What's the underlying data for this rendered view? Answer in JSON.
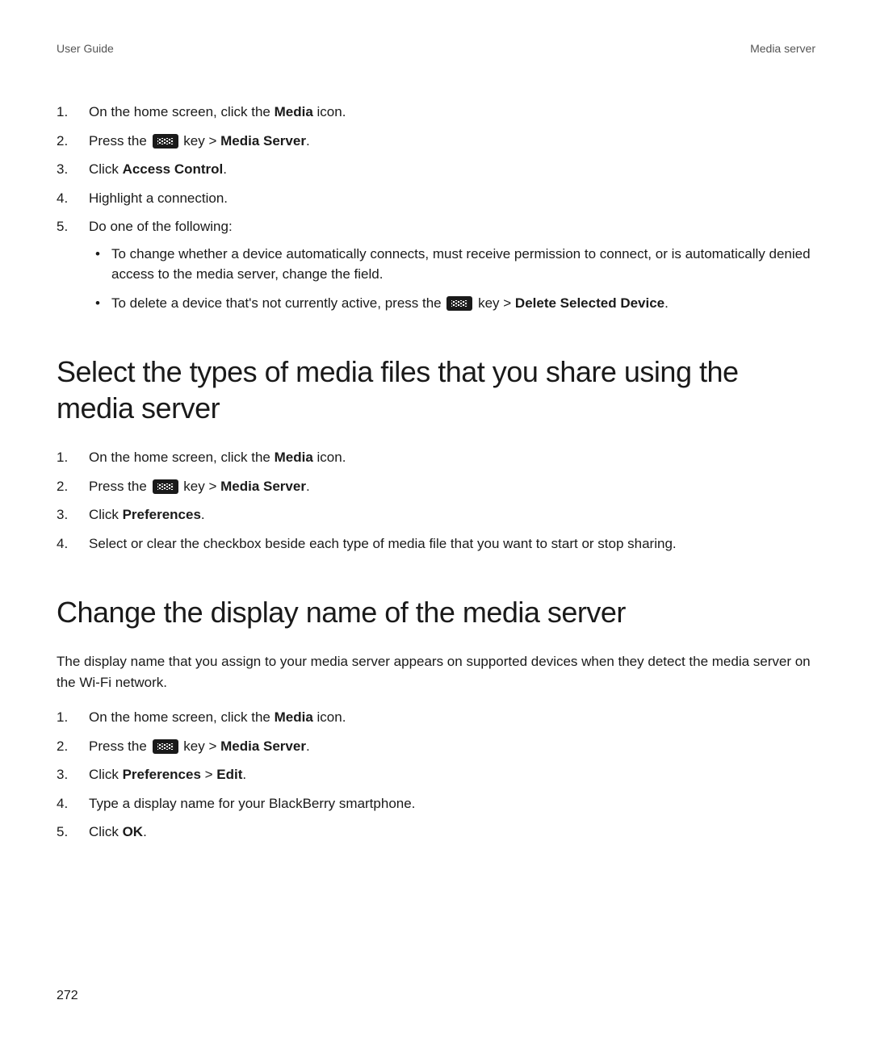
{
  "header": {
    "left": "User Guide",
    "right": "Media server"
  },
  "section1": {
    "items": {
      "1": {
        "pre": "On the home screen, click the ",
        "bold": "Media",
        "post": " icon."
      },
      "2": {
        "pre": "Press the ",
        "post_key": " key > ",
        "bold": "Media Server",
        "tail": "."
      },
      "3": {
        "pre": "Click ",
        "bold": "Access Control",
        "post": "."
      },
      "4": {
        "text": "Highlight a connection."
      },
      "5": {
        "text": "Do one of the following:"
      }
    },
    "bullets": {
      "a": "To change whether a device automatically connects, must receive permission to connect, or is automatically denied access to the media server, change the field.",
      "b": {
        "pre": "To delete a device that's not currently active, press the ",
        "post_key": " key > ",
        "bold": "Delete Selected Device",
        "tail": "."
      }
    }
  },
  "section2": {
    "heading": "Select the types of media files that you share using the media server",
    "items": {
      "1": {
        "pre": "On the home screen, click the ",
        "bold": "Media",
        "post": " icon."
      },
      "2": {
        "pre": "Press the ",
        "post_key": " key > ",
        "bold": "Media Server",
        "tail": "."
      },
      "3": {
        "pre": "Click ",
        "bold": "Preferences",
        "post": "."
      },
      "4": {
        "text": "Select or clear the checkbox beside each type of media file that you want to start or stop sharing."
      }
    }
  },
  "section3": {
    "heading": "Change the display name of the media server",
    "intro": "The display name that you assign to your media server appears on supported devices when they detect the media server on the Wi-Fi network.",
    "items": {
      "1": {
        "pre": "On the home screen, click the ",
        "bold": "Media",
        "post": " icon."
      },
      "2": {
        "pre": "Press the ",
        "post_key": " key > ",
        "bold": "Media Server",
        "tail": "."
      },
      "3": {
        "pre": "Click ",
        "bold1": "Preferences",
        "mid": " > ",
        "bold2": "Edit",
        "post": "."
      },
      "4": {
        "text": "Type a display name for your BlackBerry smartphone."
      },
      "5": {
        "pre": "Click ",
        "bold": "OK",
        "post": "."
      }
    }
  },
  "page_number": "272"
}
